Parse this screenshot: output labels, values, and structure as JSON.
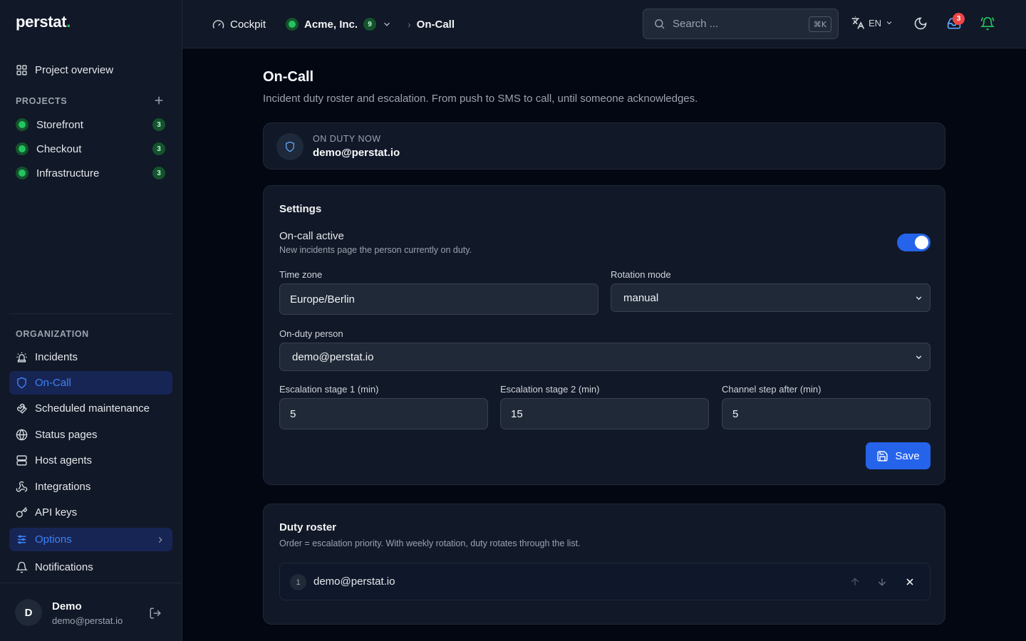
{
  "app": {
    "logo": "perstat",
    "logo_dot": "."
  },
  "sidebar": {
    "overview_label": "Project overview",
    "projects_title": "PROJECTS",
    "projects": [
      {
        "label": "Storefront",
        "count": "3",
        "status_color": "#22c55e"
      },
      {
        "label": "Checkout",
        "count": "3",
        "status_color": "#22c55e"
      },
      {
        "label": "Infrastructure",
        "count": "3",
        "status_color": "#22c55e"
      }
    ],
    "org_title": "ORGANIZATION",
    "items": [
      {
        "label": "Incidents",
        "icon": "siren-icon"
      },
      {
        "label": "On-Call",
        "icon": "shield-icon",
        "active": true
      },
      {
        "label": "Scheduled maintenance",
        "icon": "wrench-icon"
      },
      {
        "label": "Status pages",
        "icon": "globe-icon"
      },
      {
        "label": "Host agents",
        "icon": "server-icon"
      },
      {
        "label": "Integrations",
        "icon": "webhook-icon"
      },
      {
        "label": "API keys",
        "icon": "key-icon"
      },
      {
        "label": "Options",
        "icon": "sliders-icon"
      },
      {
        "label": "Notifications",
        "icon": "bell-icon"
      }
    ],
    "user": {
      "initial": "D",
      "name": "Demo",
      "email": "demo@perstat.io"
    }
  },
  "topbar": {
    "cockpit_label": "Cockpit",
    "org_label": "Acme, Inc.",
    "org_count": "9",
    "current_page": "On-Call",
    "search_placeholder": "Search ...",
    "search_shortcut": "⌘K",
    "language": "EN",
    "notification_count": "3"
  },
  "page": {
    "title": "On-Call",
    "description": "Incident duty roster and escalation. From push to SMS to call, until someone acknowledges."
  },
  "on_duty": {
    "label": "ON DUTY NOW",
    "value": "demo@perstat.io"
  },
  "settings": {
    "title": "Settings",
    "oncall_active_label": "On-call active",
    "oncall_active_desc": "New incidents page the person currently on duty.",
    "oncall_active": true,
    "timezone_label": "Time zone",
    "timezone_value": "Europe/Berlin",
    "rotation_label": "Rotation mode",
    "rotation_value": "manual",
    "person_label": "On-duty person",
    "person_value": "demo@perstat.io",
    "esc1_label": "Escalation stage 1 (min)",
    "esc1_value": "5",
    "esc2_label": "Escalation stage 2 (min)",
    "esc2_value": "15",
    "channel_label": "Channel step after (min)",
    "channel_value": "5",
    "save_label": "Save"
  },
  "roster": {
    "title": "Duty roster",
    "description": "Order = escalation priority. With weekly rotation, duty rotates through the list.",
    "entries": [
      {
        "position": "1",
        "email": "demo@perstat.io"
      }
    ]
  },
  "colors": {
    "accent": "#2563eb",
    "status_green": "#22c55e",
    "badge_red": "#ef4444"
  }
}
